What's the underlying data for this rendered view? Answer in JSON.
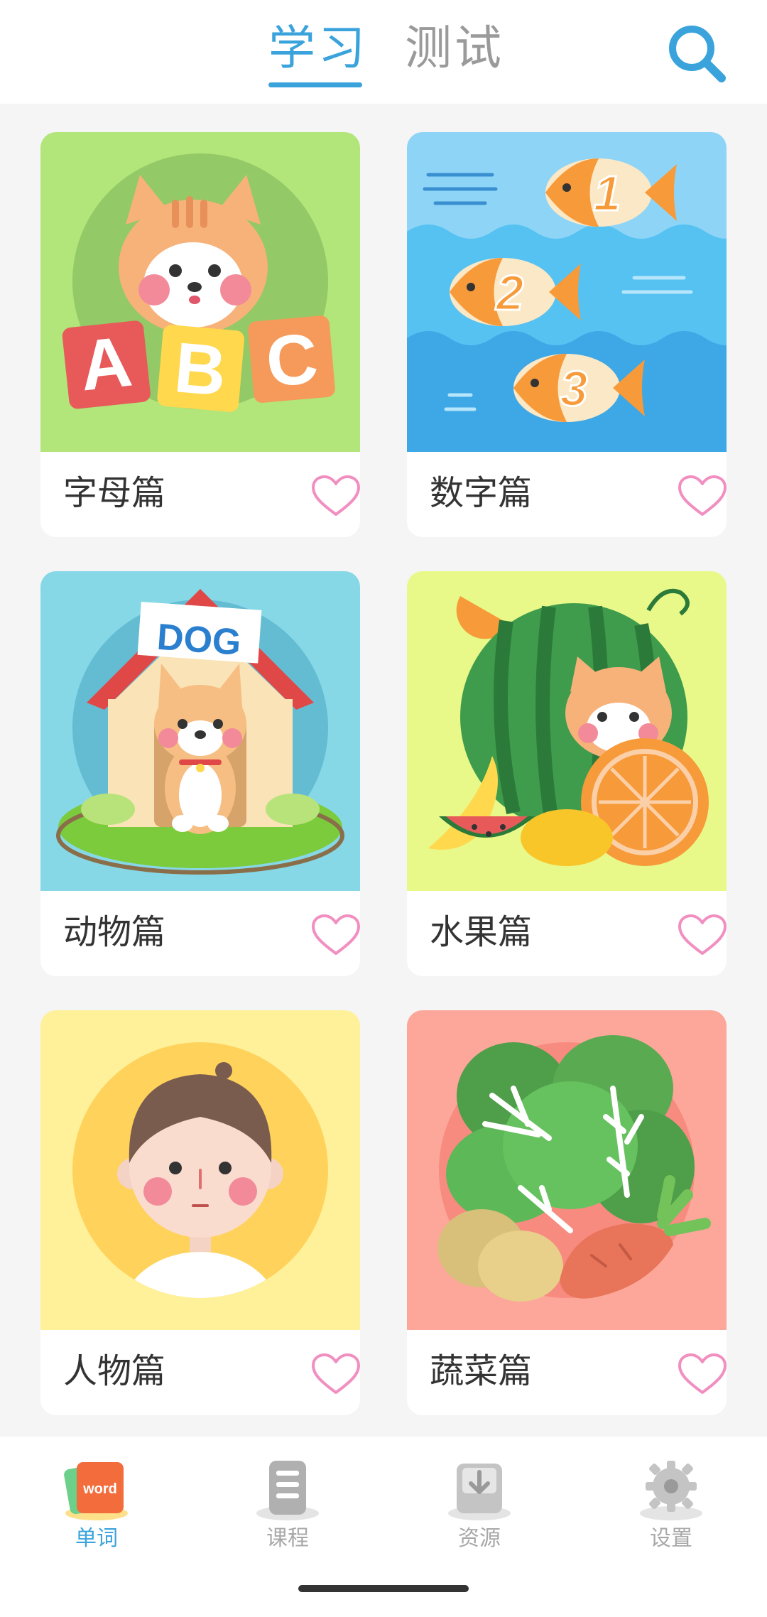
{
  "header": {
    "tabs": [
      {
        "label": "学习",
        "active": true
      },
      {
        "label": "测试",
        "active": false
      }
    ],
    "search_icon": "search-icon",
    "accent_color": "#3aa3dc"
  },
  "cards": [
    {
      "title": "字母篇",
      "image": "cat-abc-blocks",
      "image_text": "ABC",
      "favorite": false
    },
    {
      "title": "数字篇",
      "image": "numbered-fish",
      "image_numbers": [
        "1",
        "2",
        "3"
      ],
      "favorite": false
    },
    {
      "title": "动物篇",
      "image": "dog-house",
      "image_text": "DOG",
      "favorite": false
    },
    {
      "title": "水果篇",
      "image": "cat-with-fruits",
      "favorite": false
    },
    {
      "title": "人物篇",
      "image": "boy-portrait",
      "favorite": false
    },
    {
      "title": "蔬菜篇",
      "image": "vegetables",
      "favorite": false
    }
  ],
  "bottom_nav": [
    {
      "label": "单词",
      "icon": "word-book-icon",
      "icon_text": "word",
      "active": true
    },
    {
      "label": "课程",
      "icon": "course-list-icon",
      "active": false
    },
    {
      "label": "资源",
      "icon": "download-icon",
      "active": false
    },
    {
      "label": "设置",
      "icon": "gear-icon",
      "active": false
    }
  ]
}
